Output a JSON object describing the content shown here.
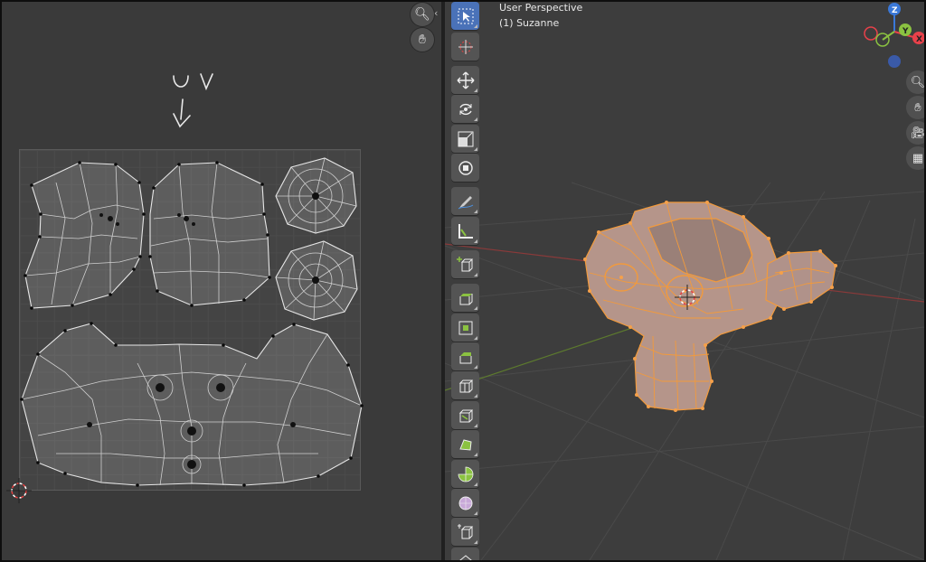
{
  "viewport": {
    "title_line": "User Perspective",
    "object_line": "(1) Suzanne"
  },
  "gizmo": {
    "z_label": "Z",
    "y_label": "Y",
    "x_label": "X",
    "colors": {
      "x": "#e8414a",
      "y": "#8bc241",
      "z": "#3a78d8"
    }
  },
  "uv_editor": {
    "nav_buttons": [
      "zoom-icon",
      "hand-icon"
    ],
    "handwriting": "UV annotation sketch"
  },
  "toolbar": {
    "tools": [
      {
        "name": "select-box-tool",
        "icon": "cursor-arrow-icon",
        "active": true
      },
      {
        "name": "cursor-tool",
        "icon": "crosshair-cursor-icon",
        "active": false
      },
      {
        "name": "move-tool",
        "icon": "move-arrows-icon",
        "active": false
      },
      {
        "name": "rotate-tool",
        "icon": "rotate-icon",
        "active": false
      },
      {
        "name": "scale-tool",
        "icon": "scale-icon",
        "active": false
      },
      {
        "name": "transform-tool",
        "icon": "transform-icon",
        "active": false
      },
      {
        "name": "annotate-tool",
        "icon": "pencil-icon",
        "active": false
      },
      {
        "name": "measure-tool",
        "icon": "ruler-icon",
        "active": false
      },
      {
        "name": "add-cube-tool",
        "icon": "add-cube-icon",
        "active": false
      },
      {
        "name": "extrude-tool",
        "icon": "extrude-icon",
        "active": false
      },
      {
        "name": "inset-tool",
        "icon": "inset-icon",
        "active": false
      },
      {
        "name": "bevel-tool",
        "icon": "bevel-icon",
        "active": false
      },
      {
        "name": "loop-cut-tool",
        "icon": "loop-cut-icon",
        "active": false
      },
      {
        "name": "knife-tool",
        "icon": "knife-icon",
        "active": false
      },
      {
        "name": "poly-build-tool",
        "icon": "poly-build-icon",
        "active": false
      },
      {
        "name": "spin-tool",
        "icon": "spin-icon",
        "active": false
      },
      {
        "name": "smooth-tool",
        "icon": "smooth-icon",
        "active": false
      },
      {
        "name": "shear-tool",
        "icon": "shear-icon",
        "active": false
      },
      {
        "name": "rip-tool",
        "icon": "rip-icon",
        "active": false
      }
    ]
  },
  "right_nav": [
    "zoom-icon",
    "hand-icon",
    "camera-icon",
    "grid-icon"
  ],
  "colors": {
    "selection": "#f29a3c",
    "uv_edge": "#e8e8e8",
    "active_tool": "#4a72b8"
  }
}
